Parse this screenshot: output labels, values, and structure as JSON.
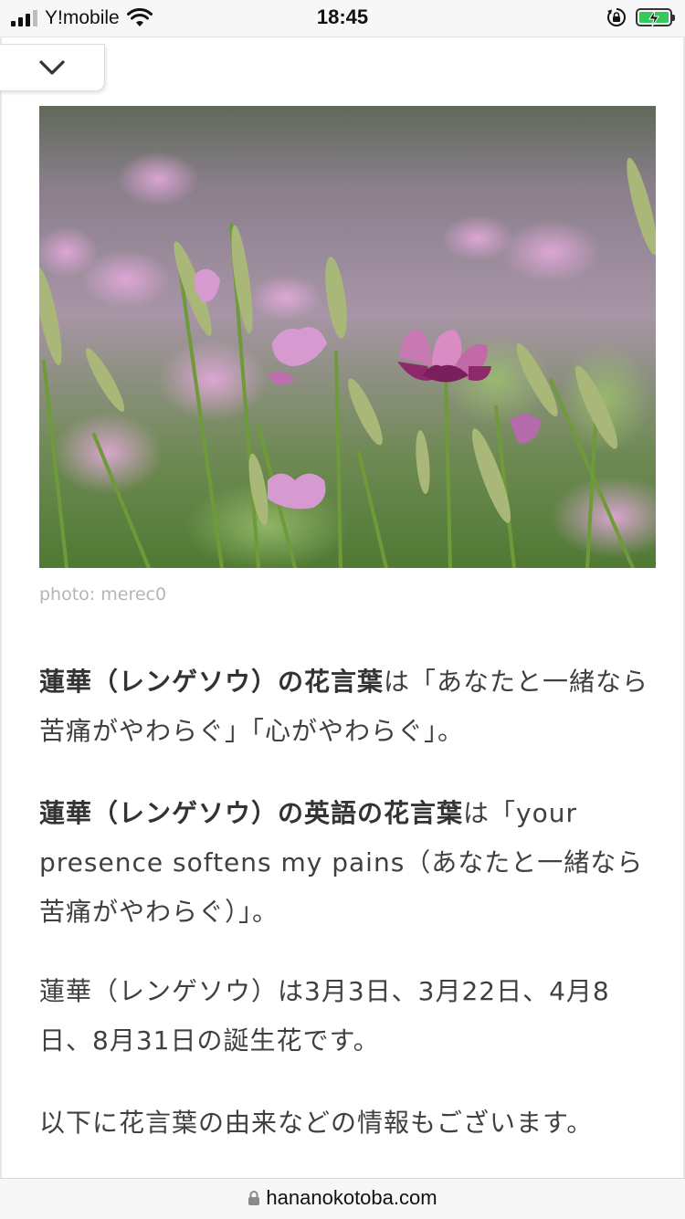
{
  "status_bar": {
    "carrier": "Y!mobile",
    "time": "18:45"
  },
  "article": {
    "photo_alt": "蓮華（レンゲソウ）",
    "photo_credit": "photo: merec0",
    "p1": {
      "strong": "蓮華（レンゲソウ）の花言葉",
      "rest": "は「あなたと一緒なら苦痛がやわらぐ」「心がやわらぐ」。"
    },
    "p2": {
      "strong": "蓮華（レンゲソウ）の英語の花言葉",
      "rest": "は「your presence softens my pains（あなたと一緒なら苦痛がやわらぐ）」。"
    },
    "p3": "蓮華（レンゲソウ）は3月3日、3月22日、4月8日、8月31日の誕生花です。",
    "p4": "以下に花言葉の由来などの情報もございます。"
  },
  "browser": {
    "url": "hananokotoba.com"
  },
  "colors": {
    "battery_fill": "#34c759",
    "text": "#404040",
    "credit": "#b5b5b5"
  },
  "icons": [
    "signal-icon",
    "wifi-icon",
    "orientation-lock-icon",
    "battery-charging-icon",
    "chevron-down-icon",
    "padlock-icon"
  ]
}
